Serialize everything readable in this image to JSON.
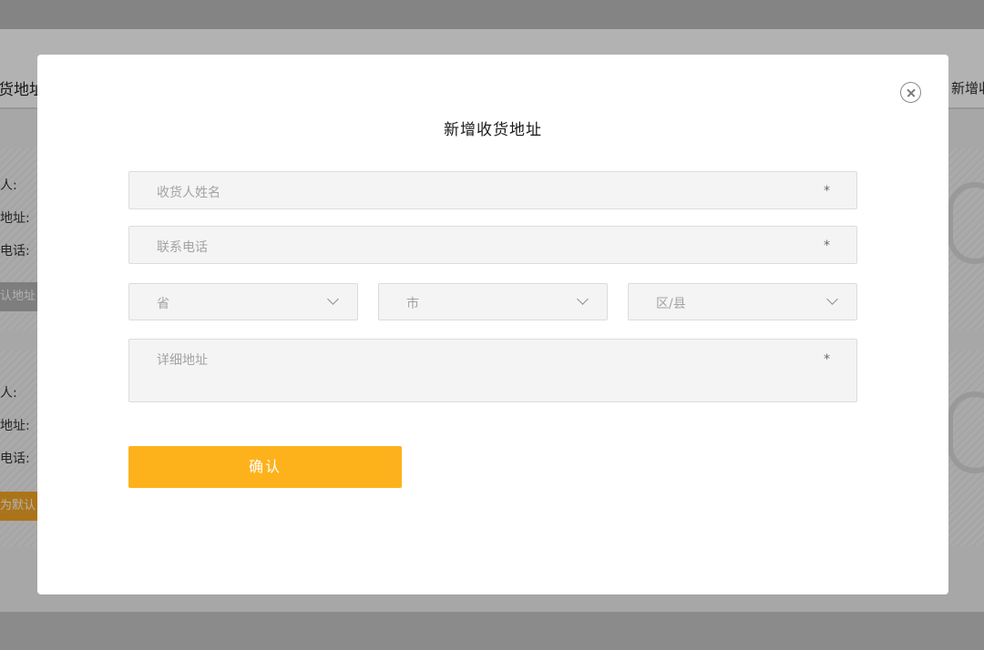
{
  "background": {
    "header_title": "货地址",
    "header_add_button": "新增收",
    "address_cards": [
      {
        "fields": [
          "人:",
          "地址:",
          "电话:"
        ],
        "button": "认地址"
      },
      {
        "fields": [
          "人:",
          "地址:",
          "电话:"
        ],
        "button": "为默认"
      }
    ]
  },
  "modal": {
    "title": "新增收货地址",
    "fields": {
      "name_placeholder": "收货人姓名",
      "phone_placeholder": "联系电话",
      "detail_placeholder": "详细地址",
      "required_mark": "*"
    },
    "selects": {
      "province": "省",
      "city": "市",
      "district": "区/县"
    },
    "confirm_label": "确认"
  },
  "colors": {
    "accent": "#fdb21c",
    "background_orange": "#f6a623",
    "input_bg": "#f4f4f4"
  },
  "icons": {
    "close": "close-icon",
    "select_arrow": "chevron-down-icon"
  }
}
